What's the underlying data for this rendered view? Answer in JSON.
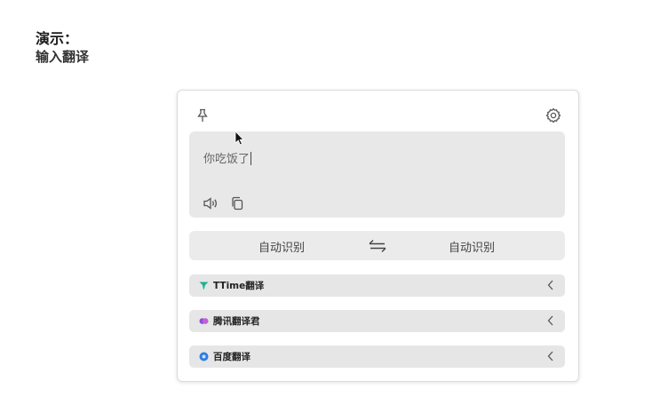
{
  "demo": {
    "title": "演示：",
    "subtitle": "输入翻译"
  },
  "toolbar": {
    "pin_icon": "pin-icon",
    "settings_icon": "gear-icon"
  },
  "input": {
    "value": "你吃饭了",
    "speak_icon": "speaker-icon",
    "copy_icon": "copy-icon"
  },
  "languages": {
    "source": "自动识别",
    "target": "自动识别",
    "swap_icon": "swap-arrows-icon"
  },
  "engines": [
    {
      "name": "TTime翻译",
      "icon": "ttime-logo-icon",
      "color": "#19b394"
    },
    {
      "name": "腾讯翻译君",
      "icon": "tencent-logo-icon",
      "color": "#8a4de0"
    },
    {
      "name": "百度翻译",
      "icon": "baidu-logo-icon",
      "color": "#2f7de1"
    }
  ]
}
